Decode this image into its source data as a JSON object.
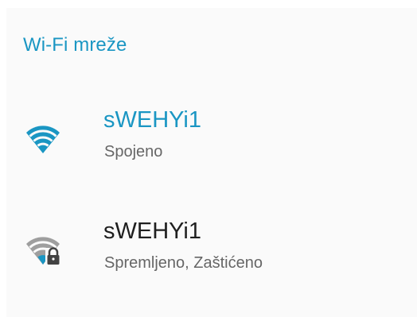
{
  "section_title": "Wi-Fi mreže",
  "colors": {
    "accent": "#1a96c3",
    "signal_grey": "#9e9e9e",
    "lock": "#424242"
  },
  "networks": [
    {
      "name": "sWEHYi1",
      "status": "Spojeno",
      "icon": "wifi-connected-icon"
    },
    {
      "name": "sWEHYi1",
      "status": "Spremljeno, Zaštićeno",
      "icon": "wifi-locked-icon"
    }
  ]
}
